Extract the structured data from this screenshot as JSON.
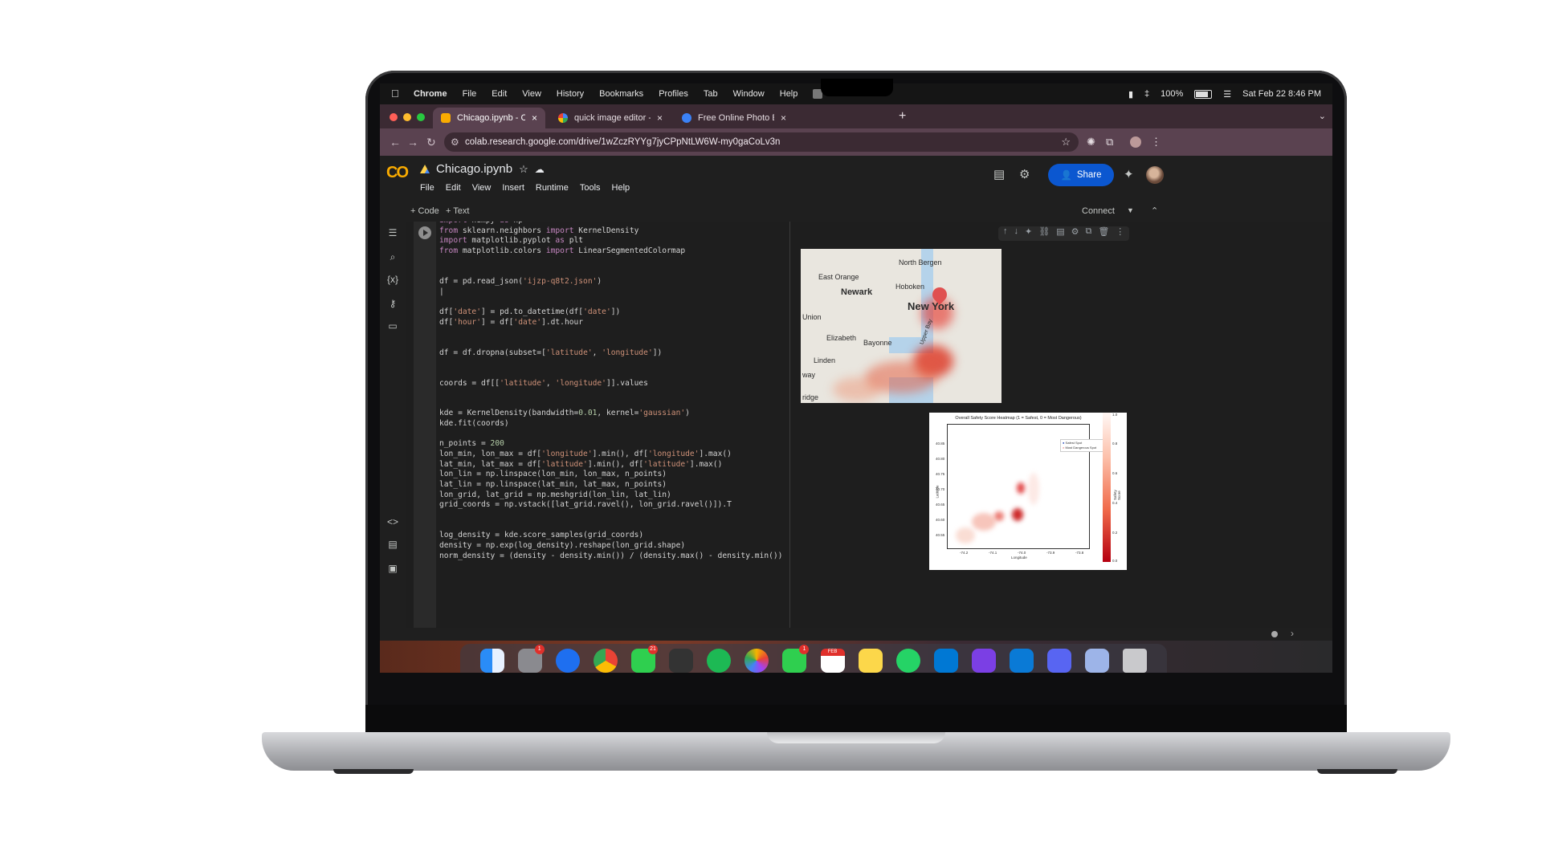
{
  "menubar": {
    "app": "Chrome",
    "items": [
      "File",
      "Edit",
      "View",
      "History",
      "Bookmarks",
      "Profiles",
      "Tab",
      "Window",
      "Help"
    ],
    "battery": "100%",
    "datetime": "Sat Feb 22  8:46 PM"
  },
  "tabs": [
    {
      "title": "Chicago.ipynb - Colab",
      "active": true,
      "icon": "colab-icon"
    },
    {
      "title": "quick image editor - Google S",
      "active": false,
      "icon": "google-icon"
    },
    {
      "title": "Free Online Photo Editor: Free",
      "active": false,
      "icon": "browser-icon"
    }
  ],
  "address": {
    "url": "colab.research.google.com/drive/1wZczRYYg7jyCPpNtLW6W-my0gaCoLv3n"
  },
  "colab": {
    "logo": "CO",
    "notebook_title": "Chicago.ipynb",
    "menu": [
      "File",
      "Edit",
      "View",
      "Insert",
      "Runtime",
      "Tools",
      "Help"
    ],
    "share_label": "Share",
    "add_code": "+ Code",
    "add_text": "+ Text",
    "connect_label": "Connect"
  },
  "code_lines": [
    "import numpy as np",
    "from sklearn.neighbors import KernelDensity",
    "import matplotlib.pyplot as plt",
    "from matplotlib.colors import LinearSegmentedColormap",
    "",
    "",
    "df = pd.read_json('ijzp-q8t2.json')",
    "|",
    "",
    "df['date'] = pd.to_datetime(df['date'])",
    "df['hour'] = df['date'].dt.hour",
    "",
    "",
    "df = df.dropna(subset=['latitude', 'longitude'])",
    "",
    "",
    "coords = df[['latitude', 'longitude']].values",
    "",
    "",
    "kde = KernelDensity(bandwidth=0.01, kernel='gaussian')",
    "kde.fit(coords)",
    "",
    "n_points = 200",
    "lon_min, lon_max = df['longitude'].min(), df['longitude'].max()",
    "lat_min, lat_max = df['latitude'].min(), df['latitude'].max()",
    "lon_lin = np.linspace(lon_min, lon_max, n_points)",
    "lat_lin = np.linspace(lat_min, lat_max, n_points)",
    "lon_grid, lat_grid = np.meshgrid(lon_lin, lat_lin)",
    "grid_coords = np.vstack([lat_grid.ravel(), lon_grid.ravel()]).T",
    "",
    "",
    "log_density = kde.score_samples(grid_coords)",
    "density = np.exp(log_density).reshape(lon_grid.shape)",
    "norm_density = (density - density.min()) / (density.max() - density.min())"
  ],
  "map_labels": {
    "north_bergen": "North Bergen",
    "east_orange": "East Orange",
    "newark": "Newark",
    "hoboken": "Hoboken",
    "new_york": "New York",
    "union": "Union",
    "elizabeth": "Elizabeth",
    "bayonne": "Bayonne",
    "linden": "Linden",
    "upper_bay": "Upper Bay",
    "way": "way",
    "ridge": "ridge"
  },
  "plot": {
    "title": "Overall Safety Score Heatmap (1 = Safest, 0 = Most Dangerous)",
    "legend": [
      "Safest Spot",
      "Most Dangerous Spot"
    ],
    "ylabel": "Latitude",
    "xlabel": "Longitude",
    "cbar_label": "Safety Score",
    "yticks": [
      "40.85",
      "40.80",
      "40.75",
      "40.70",
      "40.65",
      "40.60",
      "40.55"
    ],
    "xticks": [
      "-74.2",
      "-74.1",
      "-74.0",
      "-73.9",
      "-73.8"
    ],
    "cticks": [
      "1.0",
      "0.8",
      "0.6",
      "0.4",
      "0.2",
      "0.0"
    ]
  },
  "dock_badges": {
    "settings": "1",
    "messages": "21",
    "facetime": "1",
    "calendar": "FEB"
  }
}
